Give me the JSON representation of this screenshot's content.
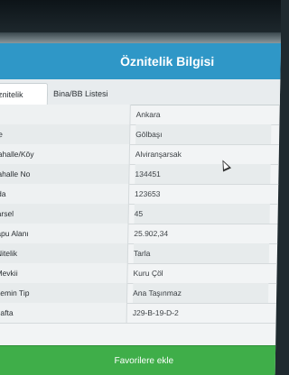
{
  "header": {
    "title": "Öznitelik Bilgisi"
  },
  "tabs": [
    {
      "label": "znitelik Bilgisi",
      "active": true
    },
    {
      "label": "Bina/BB Listesi",
      "active": false
    }
  ],
  "rows": [
    {
      "label": "",
      "value": "Ankara"
    },
    {
      "label": "e",
      "value": "Gölbaşı"
    },
    {
      "label": "ahalle/Köy",
      "value": "Alviranşarsak"
    },
    {
      "label": "ahalle No",
      "value": "134451"
    },
    {
      "label": "da",
      "value": "123653"
    },
    {
      "label": "arsel",
      "value": "45"
    },
    {
      "label": "apu Alanı",
      "value": "25.902,34"
    },
    {
      "label": "Nitelik",
      "value": "Tarla"
    },
    {
      "label": "Mevkii",
      "value": "Kuru Çöl"
    },
    {
      "label": "Zemin Tip",
      "value": "Ana Taşınmaz"
    },
    {
      "label": "Pafta",
      "value": "J29-B-19-D-2"
    }
  ],
  "footer": {
    "button_label": "Favorilere ekle"
  },
  "colors": {
    "header": "#2f97c7",
    "button": "#3fae49"
  }
}
